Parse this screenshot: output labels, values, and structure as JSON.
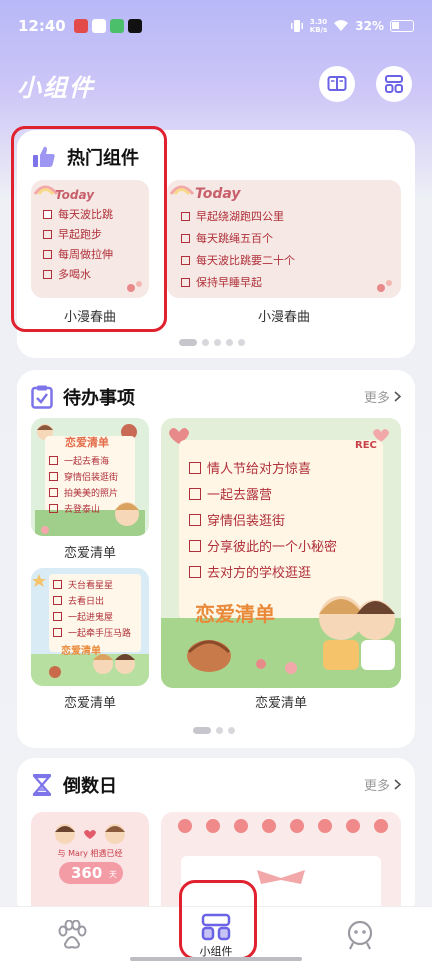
{
  "status_bar": {
    "time": "12:40",
    "speed_value": "3.30",
    "speed_unit": "KB/s",
    "battery": "32%"
  },
  "app": {
    "title": "小组件"
  },
  "hot": {
    "title": "热门组件",
    "small_widget": {
      "today": "Today",
      "items": [
        "每天波比跳",
        "早起跑步",
        "每周做拉伸",
        "多喝水"
      ],
      "caption": "小漫春曲"
    },
    "wide_widget": {
      "today": "Today",
      "items": [
        "早起绕湖跑四公里",
        "每天跳绳五百个",
        "每天波比跳要二十个",
        "保持早睡早起"
      ],
      "caption": "小漫春曲"
    }
  },
  "todo": {
    "title": "待办事项",
    "more": "更多",
    "widget1": {
      "heading": "恋爱清单",
      "items": [
        "一起去看海",
        "穿情侣装逛街",
        "拍美美的照片",
        "去登泰山"
      ],
      "caption": "恋爱清单"
    },
    "widget2": {
      "items": [
        "天台看星星",
        "去看日出",
        "一起进鬼屋",
        "一起牵手压马路"
      ],
      "footer": "恋爱清单",
      "caption": "恋爱清单"
    },
    "widget3": {
      "badge": "REC",
      "items": [
        "情人节给对方惊喜",
        "一起去露营",
        "穿情侣装逛街",
        "分享彼此的一个小秘密",
        "去对方的学校逛逛"
      ],
      "footer": "恋爱清单",
      "caption": "恋爱清单"
    }
  },
  "countdown": {
    "title": "倒数日",
    "more": "更多",
    "widget1": {
      "line": "与 Mary 相遇已经",
      "days": "360",
      "unit": "天"
    }
  },
  "bottom_nav": {
    "items": [
      {
        "label": ""
      },
      {
        "label": "小组件"
      },
      {
        "label": ""
      }
    ]
  },
  "colors": {
    "accent": "#6b63e6",
    "highlight": "#e02130",
    "note_red": "#b0303a"
  }
}
